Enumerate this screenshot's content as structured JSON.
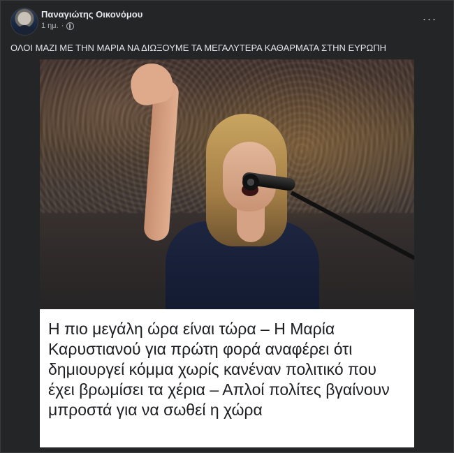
{
  "post": {
    "author_name": "Παναγιώτης Οικονόμου",
    "timestamp": "1 ημ.",
    "separator": "·",
    "audience_icon": "globe-icon",
    "more_icon": "more-horizontal-icon",
    "more_label": "···",
    "text": "ΟΛΟΙ ΜΑΖΙ ΜΕ ΤΗΝ ΜΑΡΙΑ ΝΑ ΔΙΩΞΟΥΜΕ ΤΑ ΜΕΓΑΛΥΤΕΡΑ ΚΑΘΑΡΜΑΤΑ ΣΤΗΝ ΕΥΡΩΠΗ"
  },
  "article": {
    "caption": "Η πιο μεγάλη ώρα είναι τώρα – Η Μαρία Καρυστιανού για πρώτη φορά αναφέρει ότι δημιουργεί κόμμα χωρίς κανέναν πολιτικό που έχει βρωμίσει τα χέρια – Απλοί πολίτες βγαίνουν μπροστά για να σωθεί η χώρα"
  },
  "colors": {
    "background": "#18191a",
    "card": "#242526",
    "primary_text": "#e4e6eb",
    "secondary_text": "#b0b3b8",
    "caption_bg": "#ffffff",
    "caption_text": "#1c1e21"
  }
}
